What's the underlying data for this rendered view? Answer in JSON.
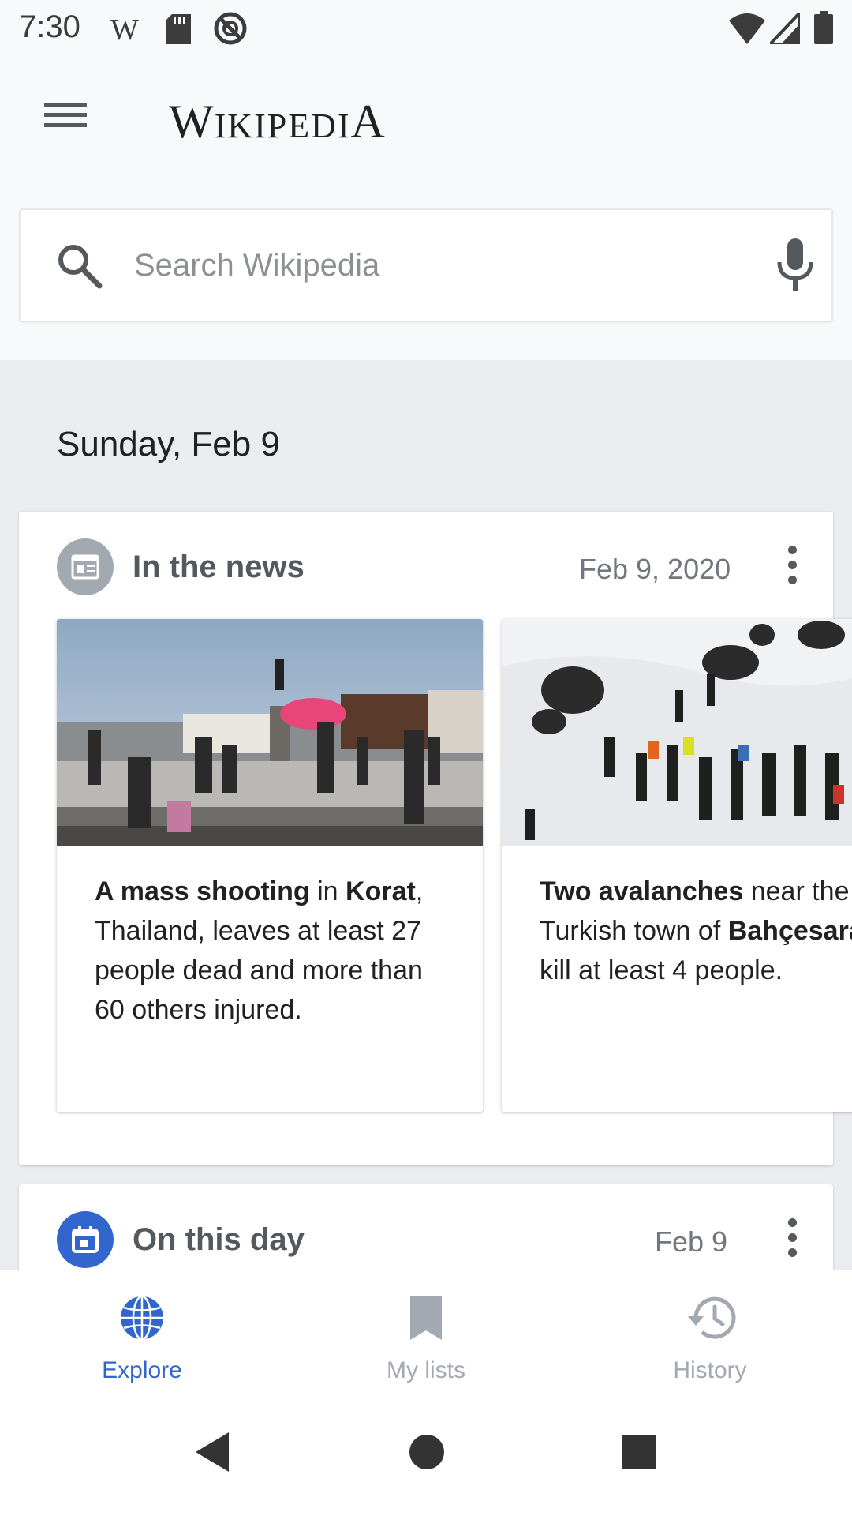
{
  "status_bar": {
    "time": "7:30",
    "left_icons": [
      "wikipedia-w-icon",
      "sd-card-icon",
      "do-not-disturb-icon"
    ],
    "right_icons": [
      "wifi-icon",
      "cell-signal-icon",
      "battery-icon"
    ],
    "w_glyph": "W"
  },
  "app_bar": {
    "menu_icon": "hamburger-menu-icon",
    "logo_text": {
      "first": "W",
      "middle": "IKIPEDI",
      "last": "A"
    }
  },
  "search": {
    "placeholder": "Search Wikipedia",
    "icon": "search-icon",
    "voice_icon": "microphone-icon"
  },
  "feed": {
    "date_heading": "Sunday, Feb 9",
    "cards": [
      {
        "title": "In the news",
        "date": "Feb 9, 2020",
        "icon": "news-icon",
        "items": [
          {
            "image": "mass-shooting-photo",
            "text_parts": [
              {
                "text": "A mass shooting",
                "bold": true
              },
              {
                "text": " in ",
                "bold": false
              },
              {
                "text": "Korat",
                "bold": true
              },
              {
                "text": ", Thailand, leaves at least 27 people dead and more than 60 others injured.",
                "bold": false
              }
            ]
          },
          {
            "image": "avalanche-photo",
            "text_parts": [
              {
                "text": "Two avalanches",
                "bold": true
              },
              {
                "text": " near the Turkish town of ",
                "bold": false
              },
              {
                "text": "Bahçesaray",
                "bold": true
              },
              {
                "text": " kill at least 4",
                "bold": false
              },
              {
                "text": " people.",
                "bold": false
              }
            ]
          }
        ]
      },
      {
        "title": "On this day",
        "date": "Feb 9",
        "icon": "calendar-icon"
      }
    ]
  },
  "bottom_nav": [
    {
      "label": "Explore",
      "icon": "globe-icon",
      "active": true
    },
    {
      "label": "My lists",
      "icon": "bookmark-icon",
      "active": false
    },
    {
      "label": "History",
      "icon": "history-icon",
      "active": false
    }
  ],
  "system_nav": [
    "back-icon",
    "home-icon",
    "recents-icon"
  ],
  "colors": {
    "accent": "#3366cc",
    "background": "#f8f9fa",
    "feed_background": "#eaecf0",
    "inactive": "#a2a9b1"
  }
}
